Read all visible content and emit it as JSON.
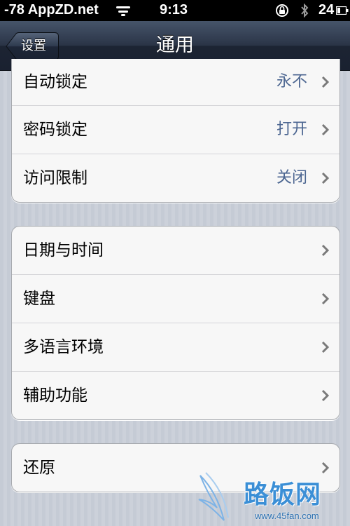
{
  "status_bar": {
    "carrier": "-78 AppZD.net",
    "time": "9:13",
    "battery": "24"
  },
  "nav": {
    "title": "通用",
    "back_label": "设置"
  },
  "groups": [
    {
      "rows": [
        {
          "label": "自动锁定",
          "value": "永不"
        },
        {
          "label": "密码锁定",
          "value": "打开"
        },
        {
          "label": "访问限制",
          "value": "关闭"
        }
      ]
    },
    {
      "rows": [
        {
          "label": "日期与时间"
        },
        {
          "label": "键盘"
        },
        {
          "label": "多语言环境"
        },
        {
          "label": "辅助功能"
        }
      ]
    },
    {
      "rows": [
        {
          "label": "还原"
        }
      ]
    }
  ],
  "watermark": {
    "brand": "路饭网",
    "url": "www.45fan.com"
  },
  "icons": {
    "chevron": "chevron-right-icon",
    "wifi": "wifi-icon",
    "lock": "rotation-lock-icon",
    "bluetooth": "bluetooth-icon",
    "battery": "battery-icon"
  },
  "colors": {
    "value_text": "#4c6691",
    "nav_bar": "#2a3446"
  }
}
